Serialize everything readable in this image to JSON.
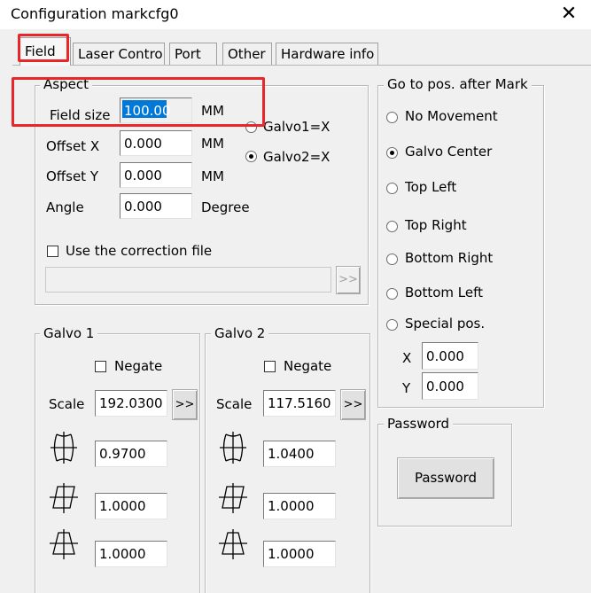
{
  "window": {
    "title": "Configuration markcfg0",
    "close_glyph": "✕"
  },
  "tabs": [
    {
      "label": "Field",
      "active": true
    },
    {
      "label": "Laser Contro"
    },
    {
      "label": "Port"
    },
    {
      "label": "Other"
    },
    {
      "label": "Hardware info"
    }
  ],
  "aspect": {
    "group_label": "Aspect",
    "field_size": {
      "label": "Field size",
      "value": "100.00",
      "unit": "MM"
    },
    "offset_x": {
      "label": "Offset X",
      "value": "0.000",
      "unit": "MM"
    },
    "offset_y": {
      "label": "Offset Y",
      "value": "0.000",
      "unit": "MM"
    },
    "angle": {
      "label": "Angle",
      "value": "0.000",
      "unit": "Degree"
    },
    "galvo1x": {
      "label": "Galvo1=X",
      "checked": false
    },
    "galvo2x": {
      "label": "Galvo2=X",
      "checked": true
    },
    "use_correction": {
      "label": "Use the correction file",
      "checked": false
    },
    "correction_path": "",
    "browse_label": ">>"
  },
  "galvo1": {
    "group_label": "Galvo 1",
    "negate_label": "Negate",
    "scale_label": "Scale",
    "scale_value": "192.0300",
    "scale_btn": ">>",
    "barrel_value": "0.9700",
    "parallelogram_value": "1.0000",
    "trapezoid_value": "1.0000",
    "icons": [
      "barrel-distortion-icon",
      "parallelogram-icon",
      "trapezoid-icon"
    ]
  },
  "galvo2": {
    "group_label": "Galvo 2",
    "negate_label": "Negate",
    "scale_label": "Scale",
    "scale_value": "117.5160",
    "scale_btn": ">>",
    "barrel_value": "1.0400",
    "parallelogram_value": "1.0000",
    "trapezoid_value": "1.0000",
    "icons": [
      "barrel-distortion-icon",
      "parallelogram-icon",
      "trapezoid-icon"
    ]
  },
  "goto": {
    "group_label": "Go to pos. after Mark",
    "options": [
      {
        "label": "No Movement",
        "checked": false
      },
      {
        "label": "Galvo Center",
        "checked": true
      },
      {
        "label": "Top Left",
        "checked": false
      },
      {
        "label": "Top Right",
        "checked": false
      },
      {
        "label": "Bottom Right",
        "checked": false
      },
      {
        "label": "Bottom Left",
        "checked": false
      },
      {
        "label": "Special pos.",
        "checked": false
      }
    ],
    "x_label": "X",
    "x_value": "0.000",
    "y_label": "Y",
    "y_value": "0.000"
  },
  "password": {
    "group_label": "Password",
    "button_label": "Password"
  },
  "colors": {
    "highlight": "#e8262b",
    "selection": "#0078d7"
  }
}
